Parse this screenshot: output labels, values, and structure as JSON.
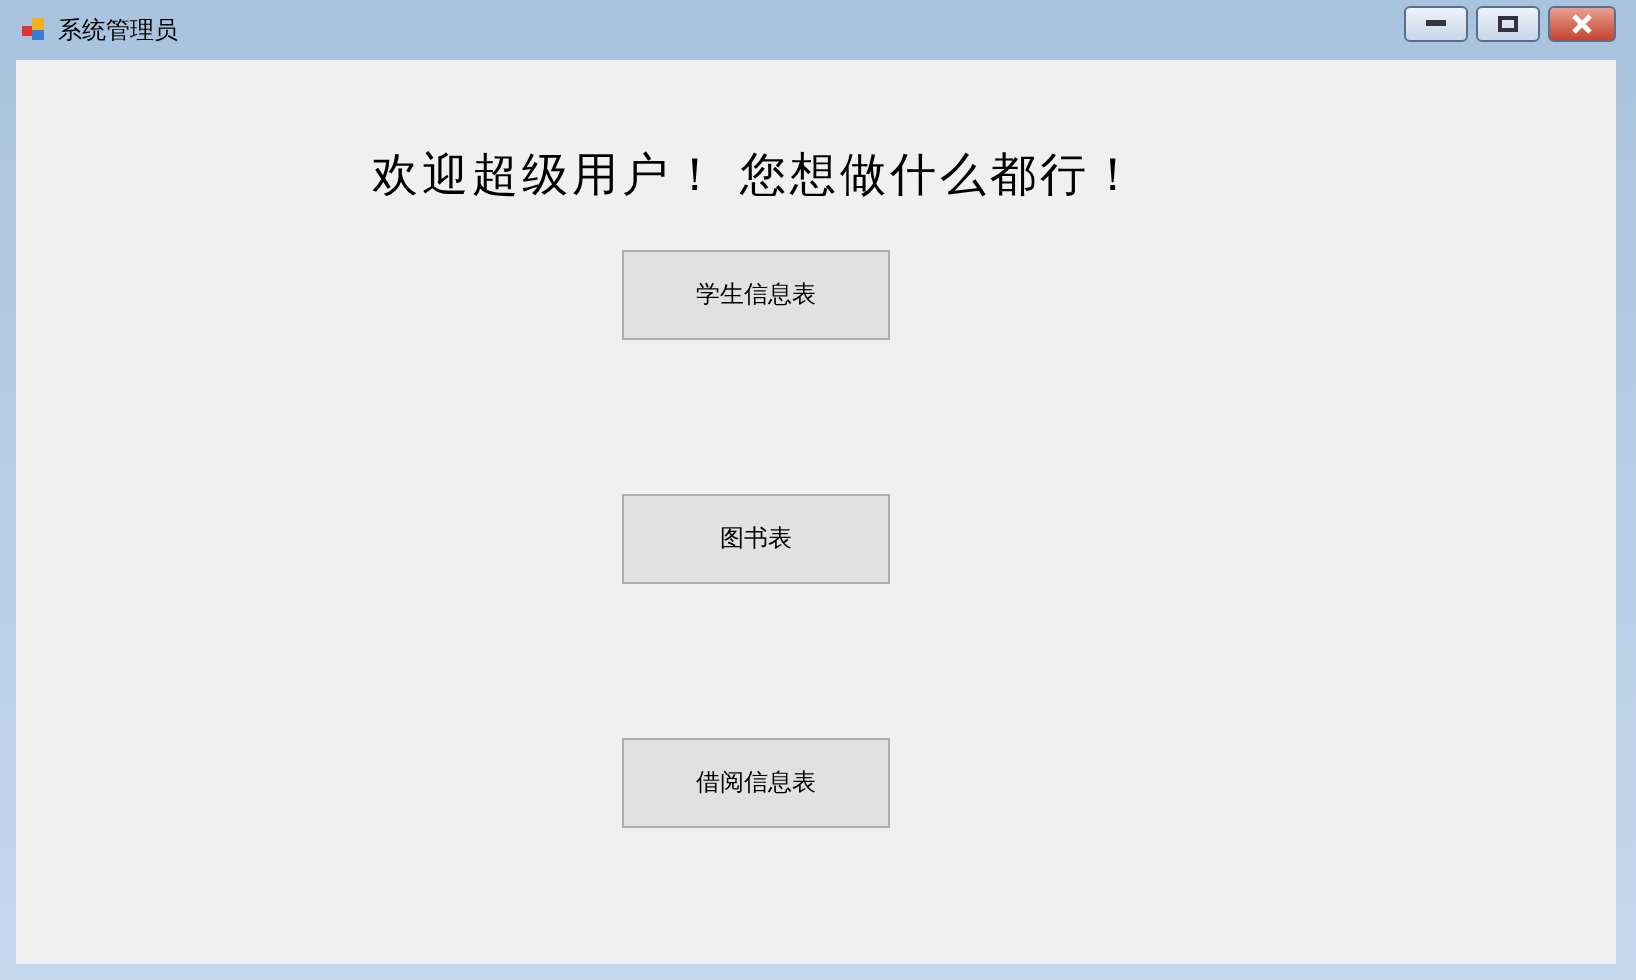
{
  "window": {
    "title": "系统管理员"
  },
  "heading": "欢迎超级用户！ 您想做什么都行！",
  "buttons": [
    "学生信息表",
    "图书表",
    "借阅信息表"
  ]
}
